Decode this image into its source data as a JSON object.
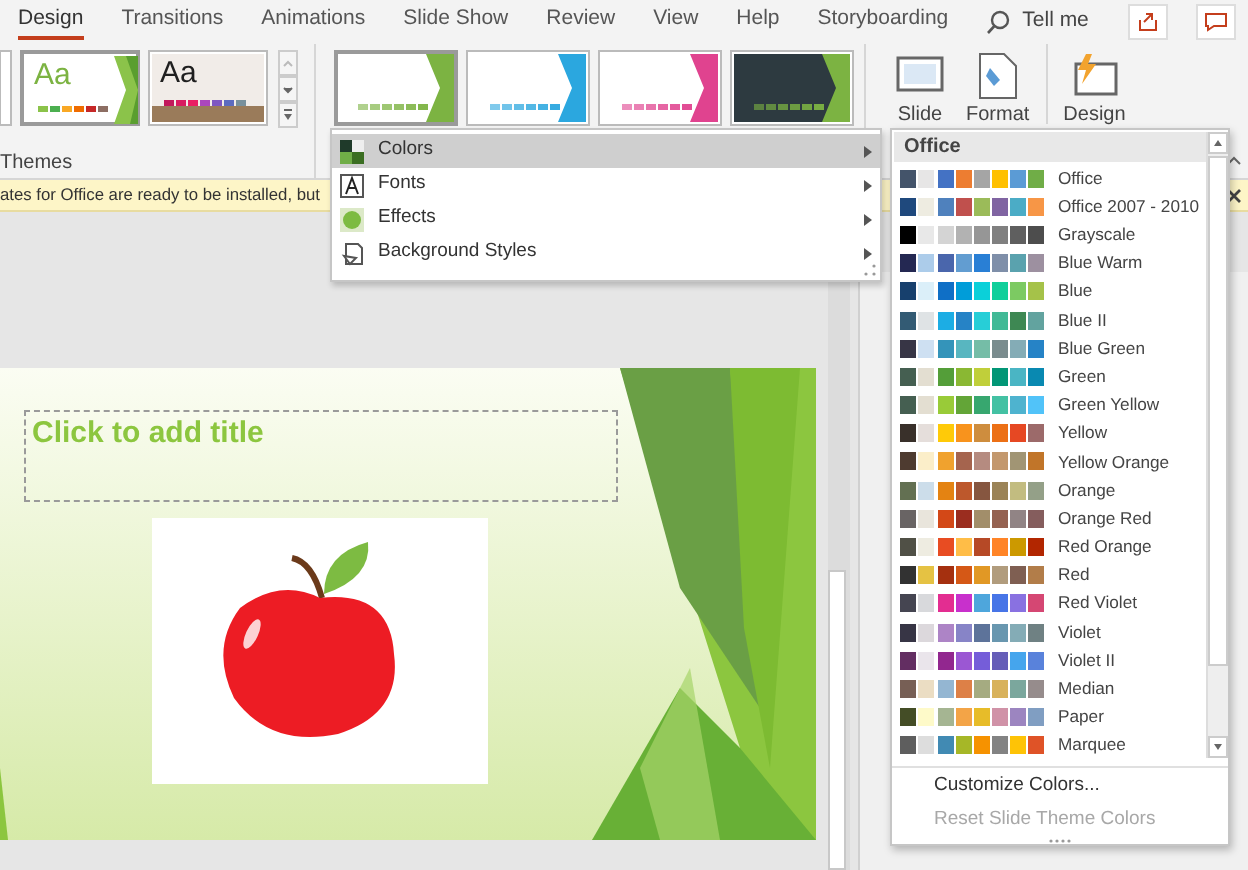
{
  "ribbon_tabs": [
    {
      "label": "Design",
      "selected": true
    },
    {
      "label": "Transitions",
      "selected": false
    },
    {
      "label": "Animations",
      "selected": false
    },
    {
      "label": "Slide Show",
      "selected": false
    },
    {
      "label": "Review",
      "selected": false
    },
    {
      "label": "View",
      "selected": false
    },
    {
      "label": "Help",
      "selected": false
    },
    {
      "label": "Storyboarding",
      "selected": false
    }
  ],
  "tell_me": "Tell me",
  "themes_gallery": {
    "label": "Themes",
    "items": [
      {
        "text": "Aa",
        "selected": true,
        "color": "#7cb342"
      },
      {
        "text": "Aa",
        "selected": false,
        "color": "#1f1f1f"
      }
    ]
  },
  "variants": [
    {
      "kind": "light",
      "selected": true,
      "color": "#7cb342"
    },
    {
      "kind": "light",
      "selected": false,
      "color": "#2ba7df"
    },
    {
      "kind": "light",
      "selected": false,
      "color": "#e0438f"
    },
    {
      "kind": "dark",
      "selected": false,
      "color": "#7cb342"
    }
  ],
  "ribbon_buttons": [
    {
      "kind": "slide-size",
      "label": "Slide"
    },
    {
      "kind": "format-background",
      "label": "Format"
    },
    {
      "kind": "design-ideas",
      "label": "Design"
    }
  ],
  "notification": {
    "text": "ates for Office are ready to be installed, but"
  },
  "variants_menu": [
    {
      "kind": "colors",
      "label": "Colors",
      "selected": true,
      "has_submenu": true
    },
    {
      "kind": "fonts",
      "label": "Fonts",
      "selected": false,
      "has_submenu": true
    },
    {
      "kind": "effects",
      "label": "Effects",
      "selected": false,
      "has_submenu": true
    },
    {
      "kind": "background",
      "label": "Background Styles",
      "selected": false,
      "has_submenu": true
    }
  ],
  "colors_submenu": {
    "header": "Office",
    "schemes": [
      {
        "name": "Office",
        "swatches": [
          {
            "color": "#44546a"
          },
          {
            "color": "#e7e6e6"
          },
          {
            "color": "#4472c4"
          },
          {
            "color": "#ed7d31"
          },
          {
            "color": "#a5a5a5"
          },
          {
            "color": "#ffc000"
          },
          {
            "color": "#5b9bd5"
          },
          {
            "color": "#70ad47"
          }
        ]
      },
      {
        "name": "Office 2007 - 2010",
        "swatches": [
          {
            "color": "#1f497d"
          },
          {
            "color": "#eeece1"
          },
          {
            "color": "#4f81bd"
          },
          {
            "color": "#c0504d"
          },
          {
            "color": "#9bbb59"
          },
          {
            "color": "#8064a2"
          },
          {
            "color": "#4bacc6"
          },
          {
            "color": "#f79646"
          }
        ]
      },
      {
        "name": "Grayscale",
        "swatches": [
          {
            "color": "#000000"
          },
          {
            "color": "#e8e8e8"
          },
          {
            "color": "#d4d4d4"
          },
          {
            "color": "#b2b2b2"
          },
          {
            "color": "#969696"
          },
          {
            "color": "#808080"
          },
          {
            "color": "#5f5f5f"
          },
          {
            "color": "#4d4d4d"
          }
        ]
      },
      {
        "name": "Blue Warm",
        "swatches": [
          {
            "color": "#242852"
          },
          {
            "color": "#acccea"
          },
          {
            "color": "#4a66ac"
          },
          {
            "color": "#629dd1"
          },
          {
            "color": "#297fd5"
          },
          {
            "color": "#7f8fa9"
          },
          {
            "color": "#5aa2ae"
          },
          {
            "color": "#9d90a0"
          }
        ]
      },
      {
        "name": "Blue",
        "swatches": [
          {
            "color": "#17406d"
          },
          {
            "color": "#dbeff9"
          },
          {
            "color": "#0f6fc6"
          },
          {
            "color": "#009dd9"
          },
          {
            "color": "#0bd0d9"
          },
          {
            "color": "#10cf9b"
          },
          {
            "color": "#7cca62"
          },
          {
            "color": "#a5c249"
          }
        ]
      },
      {
        "name": "Blue II",
        "swatches": [
          {
            "color": "#335b74"
          },
          {
            "color": "#dfe3e5"
          },
          {
            "color": "#1cade4"
          },
          {
            "color": "#2683c6"
          },
          {
            "color": "#27ced7"
          },
          {
            "color": "#42ba97"
          },
          {
            "color": "#3e8853"
          },
          {
            "color": "#62a39f"
          }
        ]
      },
      {
        "name": "Blue Green",
        "swatches": [
          {
            "color": "#373545"
          },
          {
            "color": "#cee0f2"
          },
          {
            "color": "#3494ba"
          },
          {
            "color": "#58b6c0"
          },
          {
            "color": "#75bda7"
          },
          {
            "color": "#7a8c8e"
          },
          {
            "color": "#84acb6"
          },
          {
            "color": "#2683c6"
          }
        ]
      },
      {
        "name": "Green",
        "swatches": [
          {
            "color": "#455f51"
          },
          {
            "color": "#e3ded1"
          },
          {
            "color": "#549e39"
          },
          {
            "color": "#8ab833"
          },
          {
            "color": "#c0cf3a"
          },
          {
            "color": "#029676"
          },
          {
            "color": "#4ab5c4"
          },
          {
            "color": "#0989b1"
          }
        ]
      },
      {
        "name": "Green Yellow",
        "swatches": [
          {
            "color": "#455f51"
          },
          {
            "color": "#e3ded1"
          },
          {
            "color": "#99cb38"
          },
          {
            "color": "#63a537"
          },
          {
            "color": "#37a76f"
          },
          {
            "color": "#44c1a3"
          },
          {
            "color": "#4eb3cf"
          },
          {
            "color": "#51c3f9"
          }
        ]
      },
      {
        "name": "Yellow",
        "swatches": [
          {
            "color": "#39302a"
          },
          {
            "color": "#e5dedb"
          },
          {
            "color": "#ffca08"
          },
          {
            "color": "#f8931d"
          },
          {
            "color": "#ce8d3e"
          },
          {
            "color": "#ec7016"
          },
          {
            "color": "#e64823"
          },
          {
            "color": "#9c6a6a"
          }
        ]
      },
      {
        "name": "Yellow Orange",
        "swatches": [
          {
            "color": "#4e3b30"
          },
          {
            "color": "#fbeec9"
          },
          {
            "color": "#f0a22e"
          },
          {
            "color": "#a5644e"
          },
          {
            "color": "#b58b80"
          },
          {
            "color": "#c3986d"
          },
          {
            "color": "#a19574"
          },
          {
            "color": "#c17529"
          }
        ]
      },
      {
        "name": "Orange",
        "swatches": [
          {
            "color": "#637052"
          },
          {
            "color": "#ccddea"
          },
          {
            "color": "#e48312"
          },
          {
            "color": "#bd582c"
          },
          {
            "color": "#865640"
          },
          {
            "color": "#9b8357"
          },
          {
            "color": "#c2bc80"
          },
          {
            "color": "#94a088"
          }
        ]
      },
      {
        "name": "Orange Red",
        "swatches": [
          {
            "color": "#696464"
          },
          {
            "color": "#e9e5dc"
          },
          {
            "color": "#d34817"
          },
          {
            "color": "#9b2d1f"
          },
          {
            "color": "#a28e6a"
          },
          {
            "color": "#956251"
          },
          {
            "color": "#918485"
          },
          {
            "color": "#855d5d"
          }
        ]
      },
      {
        "name": "Red Orange",
        "swatches": [
          {
            "color": "#505046"
          },
          {
            "color": "#eeece1"
          },
          {
            "color": "#e84c22"
          },
          {
            "color": "#ffbd47"
          },
          {
            "color": "#b64926"
          },
          {
            "color": "#ff8427"
          },
          {
            "color": "#cc9900"
          },
          {
            "color": "#b22600"
          }
        ]
      },
      {
        "name": "Red",
        "swatches": [
          {
            "color": "#323232"
          },
          {
            "color": "#e5c243"
          },
          {
            "color": "#a5300f"
          },
          {
            "color": "#d55816"
          },
          {
            "color": "#e19825"
          },
          {
            "color": "#b19c7d"
          },
          {
            "color": "#7f5f52"
          },
          {
            "color": "#b27d49"
          }
        ]
      },
      {
        "name": "Red Violet",
        "swatches": [
          {
            "color": "#454551"
          },
          {
            "color": "#d8d9dc"
          },
          {
            "color": "#e32d91"
          },
          {
            "color": "#c830cc"
          },
          {
            "color": "#4ea6dc"
          },
          {
            "color": "#4775e7"
          },
          {
            "color": "#8971e1"
          },
          {
            "color": "#d54773"
          }
        ]
      },
      {
        "name": "Violet",
        "swatches": [
          {
            "color": "#373545"
          },
          {
            "color": "#dcd8dc"
          },
          {
            "color": "#ad84c6"
          },
          {
            "color": "#8784c7"
          },
          {
            "color": "#5d739a"
          },
          {
            "color": "#6997af"
          },
          {
            "color": "#84acb6"
          },
          {
            "color": "#6f8183"
          }
        ]
      },
      {
        "name": "Violet II",
        "swatches": [
          {
            "color": "#632e62"
          },
          {
            "color": "#eae5eb"
          },
          {
            "color": "#92278f"
          },
          {
            "color": "#9b57d3"
          },
          {
            "color": "#755dd9"
          },
          {
            "color": "#665eb8"
          },
          {
            "color": "#45a5ed"
          },
          {
            "color": "#5982db"
          }
        ]
      },
      {
        "name": "Median",
        "swatches": [
          {
            "color": "#775f55"
          },
          {
            "color": "#ebddc3"
          },
          {
            "color": "#94b6d2"
          },
          {
            "color": "#dd8047"
          },
          {
            "color": "#a5ab81"
          },
          {
            "color": "#d8b25c"
          },
          {
            "color": "#7ba79d"
          },
          {
            "color": "#968c8c"
          }
        ]
      },
      {
        "name": "Paper",
        "swatches": [
          {
            "color": "#444d26"
          },
          {
            "color": "#fefac9"
          },
          {
            "color": "#a5b592"
          },
          {
            "color": "#f3a447"
          },
          {
            "color": "#e7bc29"
          },
          {
            "color": "#d092a7"
          },
          {
            "color": "#9c85c0"
          },
          {
            "color": "#809ec2"
          }
        ]
      },
      {
        "name": "Marquee",
        "swatches": [
          {
            "color": "#5e5e5e"
          },
          {
            "color": "#dddddd"
          },
          {
            "color": "#418ab3"
          },
          {
            "color": "#a6b727"
          },
          {
            "color": "#f69200"
          },
          {
            "color": "#838383"
          },
          {
            "color": "#fec306"
          },
          {
            "color": "#df5327"
          }
        ]
      }
    ],
    "actions": [
      {
        "label": "Customize Colors...",
        "disabled": false
      },
      {
        "label": "Reset Slide Theme Colors",
        "disabled": true
      }
    ]
  },
  "slide": {
    "title_placeholder": "Click to add title"
  }
}
